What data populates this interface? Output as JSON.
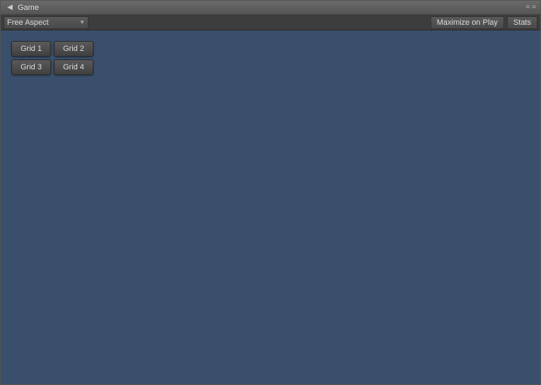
{
  "window": {
    "title": "Game",
    "icon": "◀"
  },
  "toolbar": {
    "aspect_label": "Free Aspect",
    "maximize_label": "Maximize on Play",
    "stats_label": "Stats",
    "controls": "= ="
  },
  "grid_buttons": [
    {
      "label": "Grid 1",
      "id": "grid-1"
    },
    {
      "label": "Grid 2",
      "id": "grid-2"
    },
    {
      "label": "Grid 3",
      "id": "grid-3"
    },
    {
      "label": "Grid 4",
      "id": "grid-4"
    }
  ]
}
